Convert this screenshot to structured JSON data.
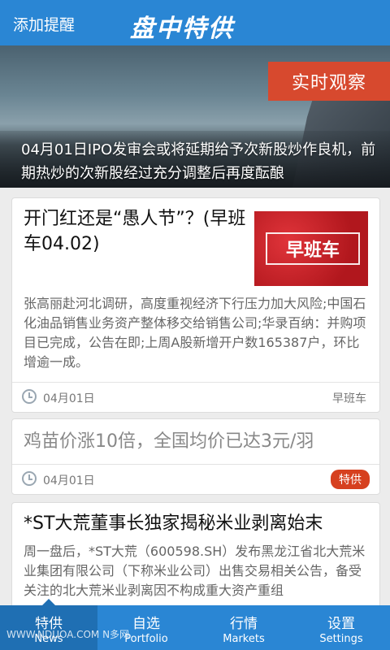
{
  "header": {
    "left_action": "添加提醒",
    "logo_text": "盘中特供"
  },
  "hero": {
    "badge": "实时观察",
    "caption": "04月01日IPO发审会或将延期给予次新股炒作良机，前期热炒的次新股经过充分调整后再度酝酿"
  },
  "articles": [
    {
      "title": "开门红还是“愚人节”？(早班车04.02)",
      "thumbnail_text": "早班车",
      "summary": "张高丽赴河北调研，高度重视经济下行压力加大风险;中国石化油品销售业务资产整体移交给销售公司;华录百纳：并购项目已完成，公告在即;上周A股新增开户数165387户，环比增逾一成。",
      "date": "04月01日",
      "tag": "早班车"
    },
    {
      "title": "鸡苗价涨10倍，全国均价已达3元/羽",
      "date": "04月01日",
      "tag": "特供"
    },
    {
      "title": "*ST大荒董事长独家揭秘米业剥离始末",
      "summary": "周一盘后，*ST大荒（600598.SH）发布黑龙江省北大荒米业集团有限公司（下称米业公司）出售交易相关公告，备受关注的北大荒米业剥离因不构成重大资产重组"
    }
  ],
  "tabs": [
    {
      "zh": "特供",
      "en": "News"
    },
    {
      "zh": "自选",
      "en": "Portfolio"
    },
    {
      "zh": "行情",
      "en": "Markets"
    },
    {
      "zh": "设置",
      "en": "Settings"
    }
  ],
  "watermark": "WWW.NDUOA.COM N多网",
  "colors": {
    "primary": "#2a86d4",
    "accent_red": "#d7492e"
  }
}
